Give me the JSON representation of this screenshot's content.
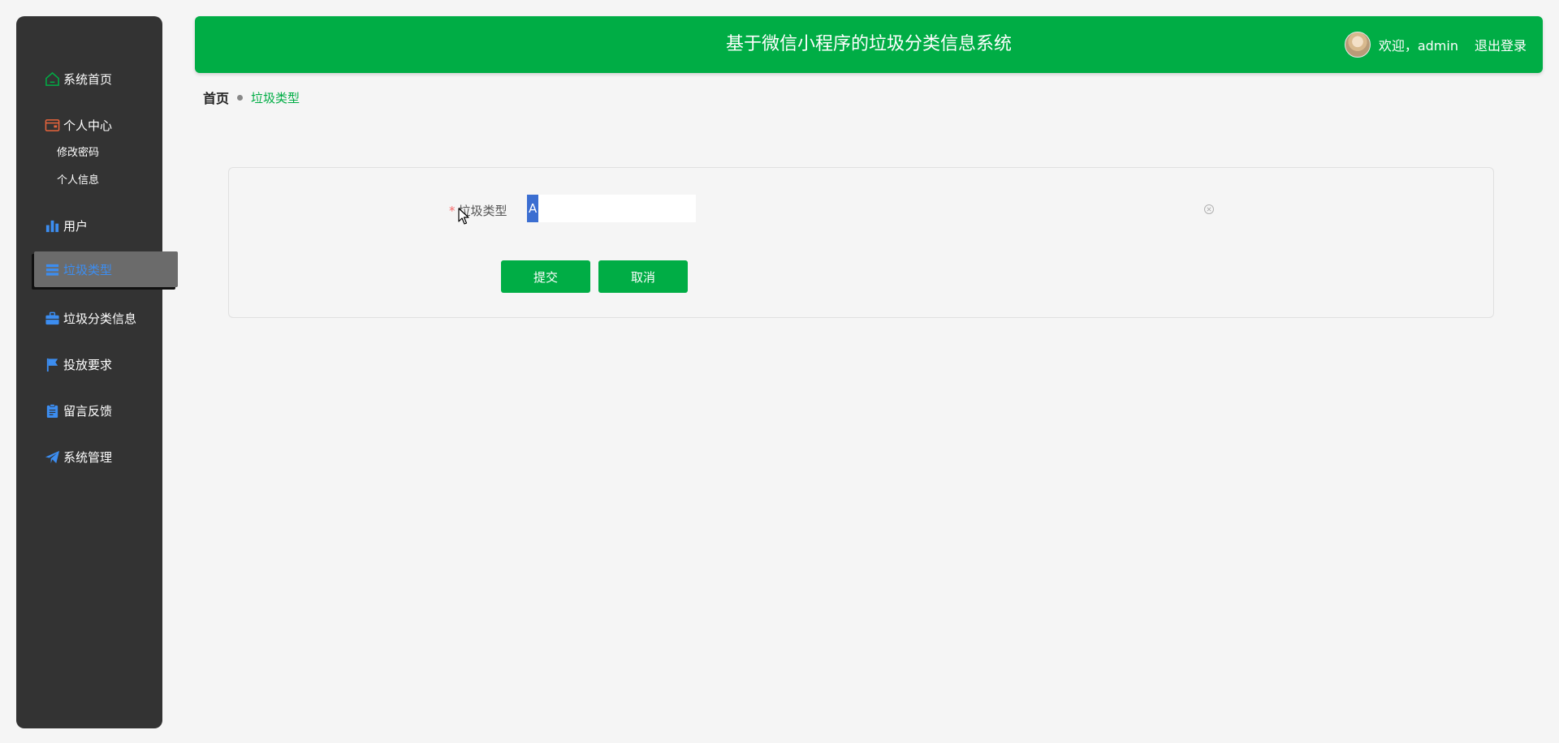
{
  "sidebar": {
    "items": [
      {
        "label": "系统首页",
        "icon": "home-icon",
        "color": "#00ad45"
      },
      {
        "label": "个人中心",
        "icon": "wallet-icon",
        "color": "#e8643c"
      },
      {
        "label": "用户",
        "icon": "bar-chart-icon",
        "color": "#3c8df0"
      },
      {
        "label": "垃圾类型",
        "icon": "list-icon",
        "color": "#3c8df0"
      },
      {
        "label": "垃圾分类信息",
        "icon": "briefcase-icon",
        "color": "#3c8df0"
      },
      {
        "label": "投放要求",
        "icon": "flag-icon",
        "color": "#3c8df0"
      },
      {
        "label": "留言反馈",
        "icon": "clipboard-icon",
        "color": "#3c8df0"
      },
      {
        "label": "系统管理",
        "icon": "send-icon",
        "color": "#3c8df0"
      }
    ],
    "sub_items": [
      "修改密码",
      "个人信息"
    ]
  },
  "header": {
    "title": "基于微信小程序的垃圾分类信息系统",
    "welcome": "欢迎，admin",
    "logout": "退出登录",
    "color": "#00ad45"
  },
  "breadcrumb": {
    "home": "首页",
    "current": "垃圾类型"
  },
  "form": {
    "label": "垃圾类型",
    "required_mark": "*",
    "value": "A",
    "submit": "提交",
    "cancel": "取消"
  }
}
